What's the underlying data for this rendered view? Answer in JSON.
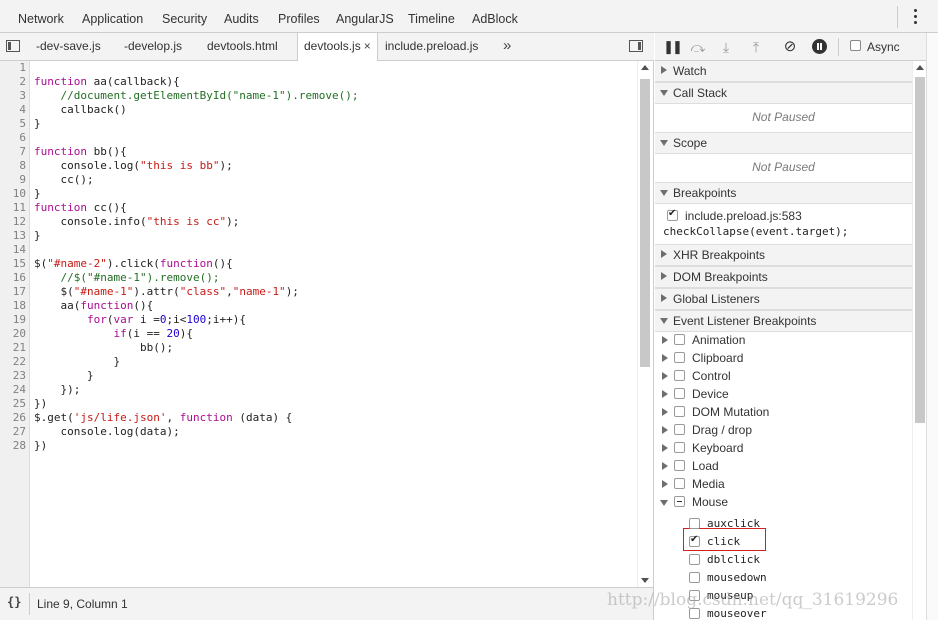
{
  "top_tabs": [
    "Network",
    "Application",
    "Security",
    "Audits",
    "Profiles",
    "AngularJS",
    "Timeline",
    "AdBlock"
  ],
  "file_tabs": [
    {
      "label": "-dev-save.js",
      "active": false
    },
    {
      "label": "-develop.js",
      "active": false
    },
    {
      "label": "devtools.html",
      "active": false
    },
    {
      "label": "devtools.js",
      "active": true
    },
    {
      "label": "include.preload.js",
      "active": false
    }
  ],
  "file_tabs_more": "»",
  "close_glyph": "×",
  "code_lines": [
    "",
    "function aa(callback){",
    "    //document.getElementById(\"name-1\").remove();",
    "    callback()",
    "}",
    "",
    "function bb(){",
    "    console.log(\"this is bb\");",
    "    cc();",
    "}",
    "function cc(){",
    "    console.info(\"this is cc\");",
    "}",
    "",
    "$(\"#name-2\").click(function(){",
    "    //$(\"#name-1\").remove();",
    "    $(\"#name-1\").attr(\"class\",\"name-1\");",
    "    aa(function(){",
    "        for(var i =0;i<100;i++){",
    "            if(i == 20){",
    "                bb();",
    "            }",
    "        }",
    "    });",
    "})",
    "$.get('js/life.json', function (data) {",
    "    console.log(data);",
    "})"
  ],
  "status": {
    "braces": "{}",
    "position": "Line 9, Column 1"
  },
  "debugger": {
    "async_label": "Async"
  },
  "sidebar": {
    "watch": "Watch",
    "call_stack": "Call Stack",
    "call_stack_empty": "Not Paused",
    "scope": "Scope",
    "scope_empty": "Not Paused",
    "breakpoints": "Breakpoints",
    "breakpoint_item": {
      "file": "include.preload.js:583",
      "code": "checkCollapse(event.target);",
      "checked": true
    },
    "xhr": "XHR Breakpoints",
    "dom": "DOM Breakpoints",
    "global": "Global Listeners",
    "event_listener": "Event Listener Breakpoints",
    "event_categories": [
      "Animation",
      "Clipboard",
      "Control",
      "Device",
      "DOM Mutation",
      "Drag / drop",
      "Keyboard",
      "Load",
      "Media",
      "Mouse"
    ],
    "mouse_events": [
      {
        "label": "auxclick",
        "checked": false
      },
      {
        "label": "click",
        "checked": true
      },
      {
        "label": "dblclick",
        "checked": false
      },
      {
        "label": "mousedown",
        "checked": false
      },
      {
        "label": "mouseup",
        "checked": false
      },
      {
        "label": "mouseover",
        "checked": false
      }
    ]
  },
  "watermark": "http://blog.csdn.net/qq_31619296",
  "colors": {
    "keyword": "#aa0d91",
    "string": "#c41a16",
    "comment": "#236e25",
    "number": "#1c00cf",
    "highlight": "#d0211f"
  }
}
